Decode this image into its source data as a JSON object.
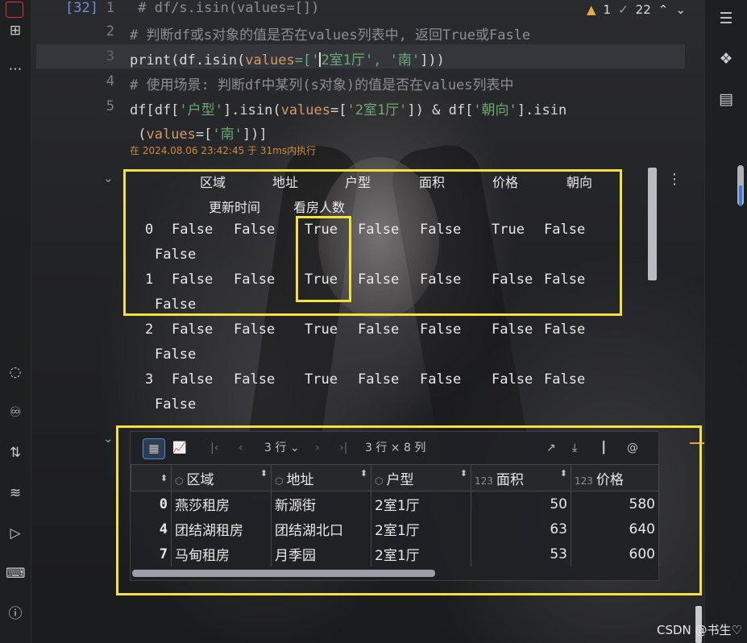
{
  "cell": {
    "exec_count": "[32]",
    "lines": [
      {
        "n": "1",
        "text": " # df/s.isin(values=[])"
      },
      {
        "n": "2",
        "text": "# 判断df或s对象的值是否在values列表中, 返回True或Fasle"
      },
      {
        "n": "3",
        "pre": "print(df.isin(",
        "kw": "values",
        "mid": "=['",
        "s1": "2室1厅', '南'",
        "end": "]))"
      },
      {
        "n": "4",
        "text": "# 使用场景: 判断df中某列(s对象)的值是否在values列表中"
      },
      {
        "n": "5",
        "a": "df[df[",
        "s1": "'户型'",
        "b": "].isin(",
        "kw": "values",
        "c": "=[",
        "s2": "'2室1厅'",
        "d": "]) & df[",
        "s3": "'朝向'",
        "e": "].isin"
      },
      {
        "n": "",
        "a": " (",
        "kw": "values",
        "b": "=[",
        "s1": "'南'",
        "c": "])]"
      }
    ],
    "exec_info": "在 2024.08.06 23:42:45 于 31ms内执行"
  },
  "inspections": {
    "warnings": "1",
    "checks": "22"
  },
  "output": {
    "headers_row1": [
      "区域",
      "地址",
      "户型",
      "面积",
      "价格",
      "朝向"
    ],
    "headers_row2": [
      "更新时间",
      "看房人数"
    ],
    "rows": [
      {
        "idx": "0",
        "vals": [
          "False",
          "False",
          "True",
          "False",
          "False",
          "True",
          "False"
        ],
        "last": "False"
      },
      {
        "idx": "1",
        "vals": [
          "False",
          "False",
          "True",
          "False",
          "False",
          "False",
          "False"
        ],
        "last": "False"
      },
      {
        "idx": "2",
        "vals": [
          "False",
          "False",
          "True",
          "False",
          "False",
          "False",
          "False"
        ],
        "last": "False"
      },
      {
        "idx": "3",
        "vals": [
          "False",
          "False",
          "True",
          "False",
          "False",
          "False",
          "False"
        ],
        "last": "False"
      }
    ]
  },
  "table_viewer": {
    "rows_label": "3 行",
    "shape_label": "3 行 × 8 列",
    "columns": [
      {
        "name": "区域",
        "type": "obj"
      },
      {
        "name": "地址",
        "type": "obj"
      },
      {
        "name": "户型",
        "type": "obj"
      },
      {
        "name": "面积",
        "type": "123"
      },
      {
        "name": "价格",
        "type": "123"
      }
    ],
    "rows": [
      {
        "idx": "0",
        "cells": [
          "燕莎租房",
          "新源街",
          "2室1厅",
          "50",
          "580"
        ]
      },
      {
        "idx": "4",
        "cells": [
          "团结湖租房",
          "团结湖北口",
          "2室1厅",
          "63",
          "640"
        ]
      },
      {
        "idx": "7",
        "cells": [
          "马甸租房",
          "月季园",
          "2室1厅",
          "53",
          "600"
        ]
      }
    ]
  },
  "watermark": "CSDN @书生♡",
  "colors": {
    "highlight_box": "#f2e23a",
    "exec_info": "#d08a38",
    "string": "#6aab73",
    "keyword": "#d19a66",
    "param": "#b689d8"
  }
}
